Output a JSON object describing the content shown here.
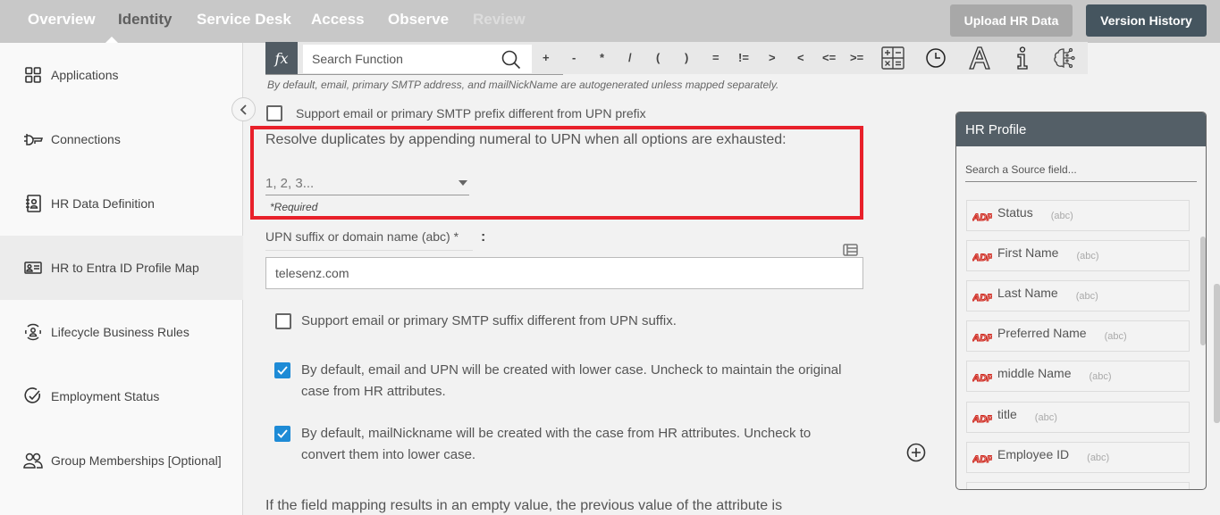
{
  "topnav": {
    "tabs": [
      {
        "label": "Overview",
        "state": "normal"
      },
      {
        "label": "Identity",
        "state": "active"
      },
      {
        "label": "Service Desk",
        "state": "normal"
      },
      {
        "label": "Access",
        "state": "normal"
      },
      {
        "label": "Observe",
        "state": "normal"
      },
      {
        "label": "Review",
        "state": "disabled"
      }
    ],
    "upload_label": "Upload HR Data",
    "version_label": "Version History"
  },
  "sidebar": {
    "items": [
      {
        "label": "Applications",
        "icon": "grid-icon"
      },
      {
        "label": "Connections",
        "icon": "plug-icon"
      },
      {
        "label": "HR Data Definition",
        "icon": "contact-book-icon"
      },
      {
        "label": "HR to Entra ID Profile Map",
        "icon": "id-card-icon",
        "active": true
      },
      {
        "label": "Lifecycle Business Rules",
        "icon": "user-cycle-icon"
      },
      {
        "label": "Employment Status",
        "icon": "check-circle-icon"
      },
      {
        "label": "Group Memberships [Optional]",
        "icon": "users-icon"
      }
    ]
  },
  "fxbar": {
    "fx_label": "fx",
    "search_placeholder": "Search Function",
    "operators": [
      "+",
      "-",
      "*",
      "/",
      "(",
      ")",
      "=",
      "!=",
      ">",
      "<",
      "<=",
      ">="
    ],
    "tools": [
      "calculator-icon",
      "clock-icon",
      "text-a-icon",
      "info-icon",
      "ai-brain-icon"
    ]
  },
  "form": {
    "hint": "By default, email, primary SMTP address, and mailNickName are autogenerated unless mapped separately.",
    "prefix_checkbox": {
      "label": "Support email or primary SMTP prefix different from UPN prefix",
      "checked": false
    },
    "duplicate_label": "Resolve duplicates by appending numeral to UPN when all options are exhausted:",
    "duplicate_select": {
      "value": "1, 2, 3...",
      "required_note": "*Required"
    },
    "upn_label": "UPN suffix or domain name (abc) *",
    "upn_colon": ":",
    "upn_value": "telesenz.com",
    "suffix_checkbox": {
      "label": "Support email or primary SMTP suffix different from UPN suffix.",
      "checked": false
    },
    "lowercase_checkbox": {
      "label_line1": "By default, email and UPN will be created with lower case. Uncheck to maintain the original",
      "label_line2": "case from HR attributes.",
      "checked": true
    },
    "nickname_checkbox": {
      "label_line1": "By default, mailNickname will be created with the case from HR attributes. Uncheck to",
      "label_line2": "convert them into lower case.",
      "checked": true
    },
    "empty_value_note": "If the field mapping results in an empty value, the previous value of the attribute is"
  },
  "hr_profile": {
    "title": "HR Profile",
    "search_placeholder": "Search a Source field...",
    "fields": [
      {
        "name": "Status",
        "type": "(abc)"
      },
      {
        "name": "First Name",
        "type": "(abc)"
      },
      {
        "name": "Last Name",
        "type": "(abc)"
      },
      {
        "name": "Preferred Name",
        "type": "(abc)"
      },
      {
        "name": "middle Name",
        "type": "(abc)"
      },
      {
        "name": "title",
        "type": "(abc)"
      },
      {
        "name": "Employee ID",
        "type": "(abc)"
      }
    ]
  },
  "colors": {
    "highlight": "#e8202a",
    "checkbox": "#1e8bd6",
    "header_dark": "#45555f",
    "adp_red": "#d0271d"
  }
}
